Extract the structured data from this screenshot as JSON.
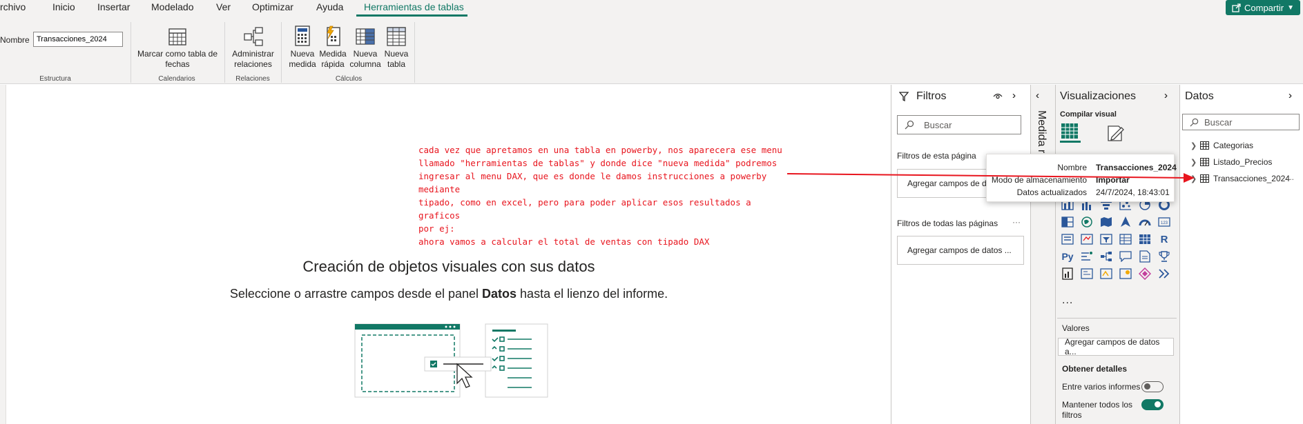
{
  "menu": {
    "items": [
      "rchivo",
      "Inicio",
      "Insertar",
      "Modelado",
      "Ver",
      "Optimizar",
      "Ayuda",
      "Herramientas de tablas"
    ],
    "share_label": "Compartir"
  },
  "ribbon": {
    "name_label": "Nombre",
    "name_value": "Transacciones_2024",
    "groups": {
      "estructura": "Estructura",
      "calendarios": "Calendarios",
      "relaciones": "Relaciones",
      "calculos": "Cálculos"
    },
    "buttons": {
      "marcar": "Marcar como tabla de fechas",
      "administrar": "Administrar relaciones",
      "nueva_medida": "Nueva medida",
      "medida_rapida": "Medida rápida",
      "nueva_columna": "Nueva columna",
      "nueva_tabla": "Nueva tabla"
    }
  },
  "canvas": {
    "annotation": "cada vez que apretamos en una tabla en powerby, nos aparecera ese menu\nllamado \"herramientas de tablas\" y donde dice \"nueva medida\" podremos\ningresar al menu DAX, que es donde le damos instrucciones a powerby mediante\ntipado, como en excel, pero para poder aplicar esos resultados a graficos\npor ej:\nahora vamos a calcular el total de ventas con tipado DAX",
    "title": "Creación de objetos visuales con sus datos",
    "sub_before": "Seleccione o arrastre campos desde el panel ",
    "sub_bold": "Datos",
    "sub_after": " hasta el lienzo del informe."
  },
  "filters": {
    "title": "Filtros",
    "search_placeholder": "Buscar",
    "this_page_label": "Filtros de esta página",
    "this_page_drop": "Agregar campos de d",
    "all_pages_label": "Filtros de todas las páginas",
    "all_pages_drop": "Agregar campos de datos ..."
  },
  "collapsed_strip": {
    "text": "Medida r"
  },
  "visualizations": {
    "title": "Visualizaciones",
    "compile_label": "Compilar visual",
    "values_label": "Valores",
    "values_drop": "Agregar campos de datos a...",
    "details_label": "Obtener detalles",
    "cross_reports_label": "Entre varios informes",
    "keep_filters_label": "Mantener todos los filtros",
    "cross_reports_on": false,
    "keep_filters_on": true,
    "more_label": "..."
  },
  "data_pane": {
    "title": "Datos",
    "search_placeholder": "Buscar",
    "tables": [
      "Categorias",
      "Listado_Precios",
      "Transacciones_2024"
    ],
    "more": "..."
  },
  "tooltip": {
    "rows": [
      {
        "key": "Nombre",
        "value": "Transacciones_2024"
      },
      {
        "key": "Modo de almacenamiento",
        "value": "Importar"
      },
      {
        "key": "Datos actualizados",
        "value": "24/7/2024, 18:43:01"
      }
    ]
  },
  "colors": {
    "accent": "#117865",
    "annotation_red": "#e8151e",
    "visual_blue": "#2b579a"
  }
}
